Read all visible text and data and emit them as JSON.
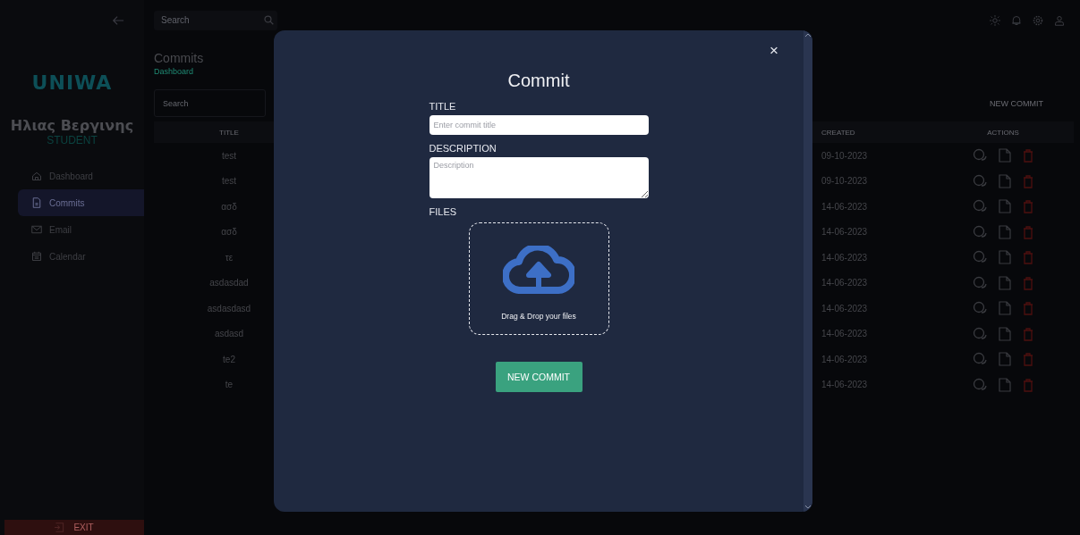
{
  "sidebar": {
    "logo": "UNIWA",
    "user": {
      "name": "Ηλιας Βεργινης",
      "role": "STUDENT"
    },
    "items": [
      {
        "label": "Dashboard",
        "selected": false
      },
      {
        "label": "Commits",
        "selected": true
      },
      {
        "label": "Email",
        "selected": false
      },
      {
        "label": "Calendar",
        "selected": false
      }
    ],
    "exit": "EXIT"
  },
  "topbar": {
    "search": {
      "placeholder": "Search"
    }
  },
  "page": {
    "title": "Commits",
    "breadcrumb": "Dashboard",
    "search": {
      "placeholder": "Search"
    },
    "new_button": "NEW COMMIT"
  },
  "table": {
    "columns": [
      "TITLE",
      "CREATED",
      "ACTIONS"
    ],
    "rows": [
      {
        "title": "test",
        "created": "09-10-2023"
      },
      {
        "title": "test",
        "created": "09-10-2023"
      },
      {
        "title": "ασδ",
        "created": "14-06-2023"
      },
      {
        "title": "ασδ",
        "created": "14-06-2023"
      },
      {
        "title": "τε",
        "created": "14-06-2023"
      },
      {
        "title": "asdasdad",
        "created": "14-06-2023"
      },
      {
        "title": "asdasdasd",
        "created": "14-06-2023"
      },
      {
        "title": "asdasd",
        "created": "14-06-2023"
      },
      {
        "title": "te2",
        "created": "14-06-2023"
      },
      {
        "title": "te",
        "created": "14-06-2023"
      }
    ]
  },
  "modal": {
    "title": "Commit",
    "close": "×",
    "fields": [
      {
        "label": "TITLE",
        "kind": "input",
        "placeholder": "Enter commit title"
      },
      {
        "label": "DESCRIPTION",
        "kind": "textarea",
        "placeholder": "Description"
      }
    ],
    "files_label": "FILES",
    "dropzone": "Drag & Drop your files",
    "submit": "NEW COMMIT"
  }
}
